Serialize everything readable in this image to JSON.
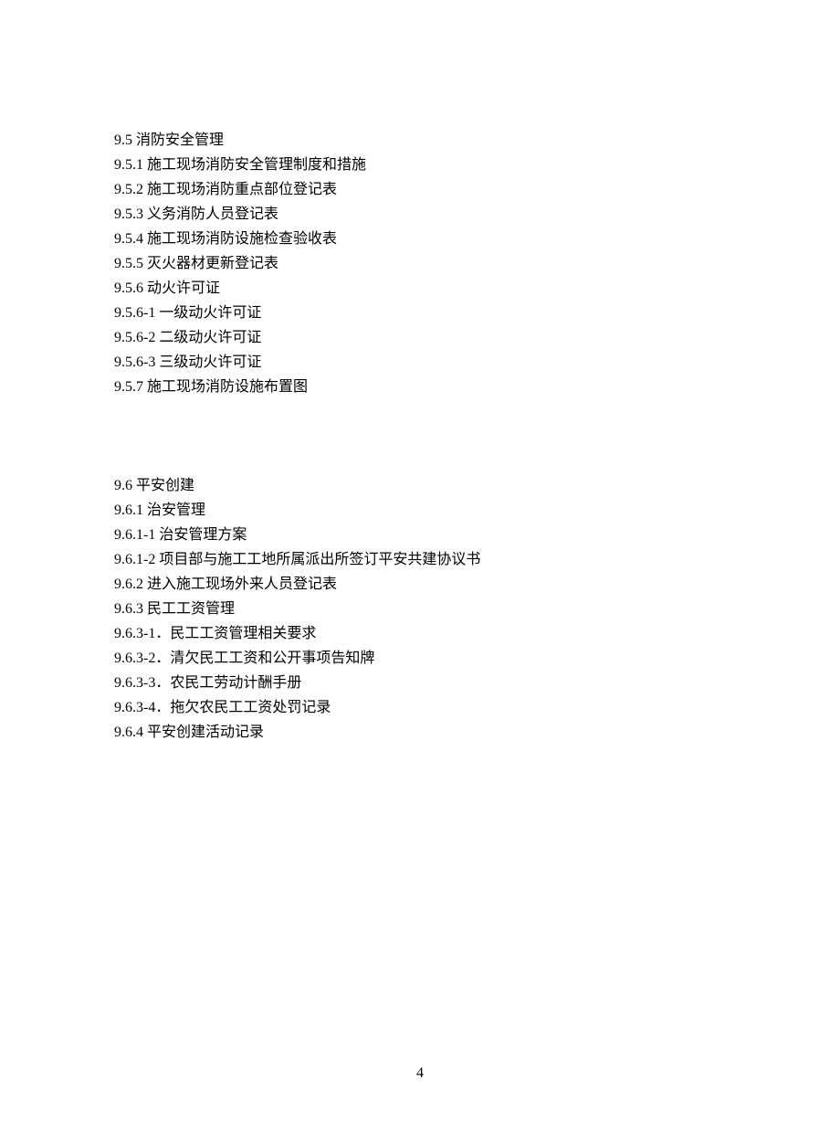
{
  "section1": {
    "lines": [
      "9.5  消防安全管理",
      "9.5.1  施工现场消防安全管理制度和措施",
      "9.5.2  施工现场消防重点部位登记表",
      "9.5.3  义务消防人员登记表",
      "9.5.4  施工现场消防设施检查验收表",
      "9.5.5  灭火器材更新登记表",
      "9.5.6  动火许可证",
      "9.5.6-1  一级动火许可证",
      "9.5.6-2  二级动火许可证",
      "9.5.6-3  三级动火许可证",
      "9.5.7  施工现场消防设施布置图"
    ]
  },
  "section2": {
    "lines": [
      "9.6  平安创建",
      "9.6.1  治安管理",
      "9.6.1-1  治安管理方案",
      "9.6.1-2  项目部与施工工地所属派出所签订平安共建协议书",
      "9.6.2  进入施工现场外来人员登记表",
      "9.6.3  民工工资管理",
      "9.6.3-1．民工工资管理相关要求",
      "9.6.3-2．清欠民工工资和公开事项告知牌",
      "9.6.3-3．农民工劳动计酬手册",
      "9.6.3-4．拖欠农民工工资处罚记录",
      "9.6.4  平安创建活动记录"
    ]
  },
  "pageNumber": "4"
}
